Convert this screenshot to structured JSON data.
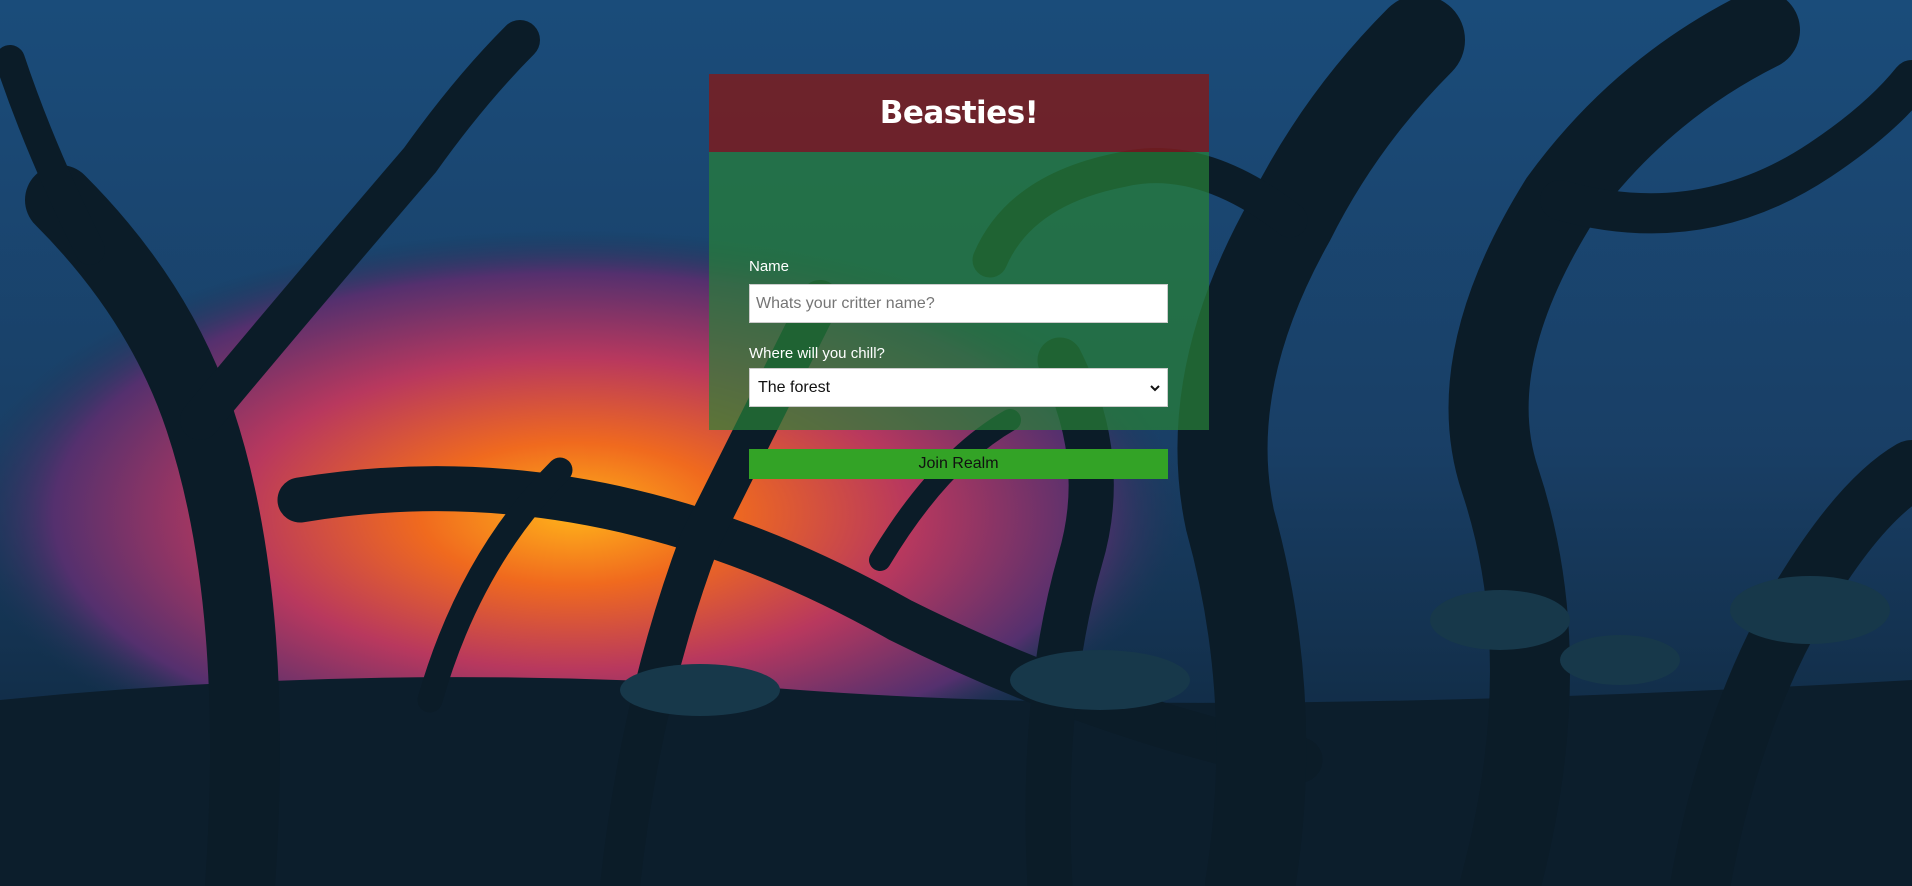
{
  "app": {
    "title": "Beasties!"
  },
  "form": {
    "name_label": "Name",
    "name_placeholder": "Whats your critter name?",
    "name_value": "",
    "realm_label": "Where will you chill?",
    "realm_selected": "The forest",
    "join_label": "Join Realm"
  },
  "colors": {
    "header_bg": "#7d1c1e",
    "body_bg": "#28823a",
    "button_bg": "#33a326"
  },
  "icons": {
    "select_arrow": "chevron-down-icon"
  }
}
